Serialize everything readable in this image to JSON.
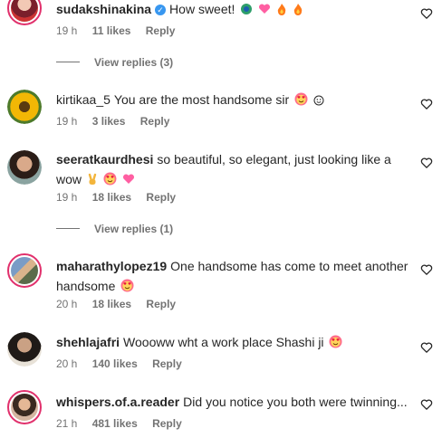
{
  "comments": [
    {
      "username": "sudakshinakina",
      "verified": true,
      "text": "How sweet!",
      "emojis": [
        "peacock",
        "pink-heart",
        "fire",
        "fire"
      ],
      "time": "19 h",
      "likes": "11 likes",
      "reply": "Reply",
      "view_replies": "View replies (3)"
    },
    {
      "username": "kirtikaa_5",
      "verified": false,
      "text": "You are the most handsome sir",
      "emojis": [
        "heart-eyes",
        "smile"
      ],
      "time": "19 h",
      "likes": "3 likes",
      "reply": "Reply"
    },
    {
      "username": "seeratkaurdhesi",
      "verified": false,
      "text": "so beautiful, so elegant, just looking like a wow",
      "emojis": [
        "victory-hand",
        "heart-eyes",
        "pink-heart"
      ],
      "time": "19 h",
      "likes": "18 likes",
      "reply": "Reply",
      "view_replies": "View replies (1)"
    },
    {
      "username": "maharathylopez19",
      "verified": false,
      "text": "One handsome has come to meet another handsome",
      "emojis": [
        "heart-eyes"
      ],
      "time": "20 h",
      "likes": "18 likes",
      "reply": "Reply"
    },
    {
      "username": "shehlajafri",
      "verified": false,
      "text": "Woooww wht a work place Shashi ji",
      "emojis": [
        "heart-eyes"
      ],
      "time": "20 h",
      "likes": "140 likes",
      "reply": "Reply"
    },
    {
      "username": "whispers.of.a.reader",
      "verified": false,
      "text": "Did you notice you both were twinning...",
      "emojis": [],
      "time": "21 h",
      "likes": "481 likes",
      "reply": "Reply"
    }
  ],
  "colors": {
    "verified": "#3897f0",
    "story_ring": "#e1306c",
    "muted": "#737373"
  },
  "icons": {
    "like": "heart-outline-icon"
  }
}
